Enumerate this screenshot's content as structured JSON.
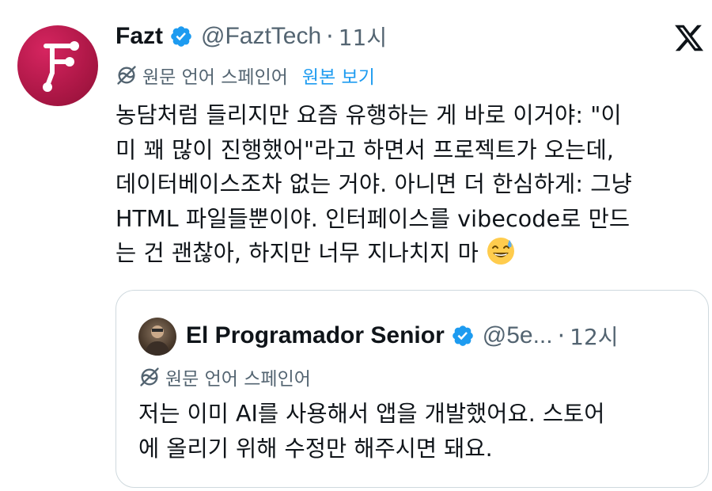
{
  "tweet": {
    "author_name": "Fazt",
    "handle": "@FaztTech",
    "separator": "·",
    "time": "11시",
    "translation_notice": "원문 언어 스페인어",
    "show_original": "원본 보기",
    "body_lines": [
      "농담처럼 들리지만 요즘 유행하는 게 바로 이거야: \"이",
      "미 꽤 많이 진행했어\"라고 하면서 프로젝트가 오는데,",
      "데이터베이스조차 없는 거야. 아니면 더 한심하게: 그냥",
      "HTML 파일들뿐이야. 인터페이스를 vibecode로 만드",
      "는 건 괜찮아, 하지만 너무 지나치지 마"
    ],
    "emoji": "sweat-smile-emoji",
    "colors": {
      "accent": "#1d9bf0",
      "muted": "#536471",
      "text": "#0f1419",
      "avatar": "#b01848"
    }
  },
  "quoted_tweet": {
    "author_name": "El Programador Senior",
    "handle": "@5e...",
    "separator": "·",
    "time": "12시",
    "translation_notice": "원문 언어 스페인어",
    "body_lines": [
      "저는 이미 AI를 사용해서 앱을 개발했어요. 스토어",
      "에 올리기 위해 수정만 해주시면 돼요."
    ]
  }
}
